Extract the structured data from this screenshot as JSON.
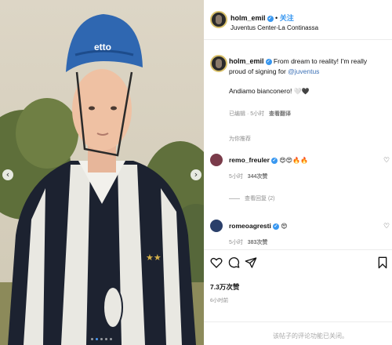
{
  "post": {
    "username": "holm_emil",
    "follow_label": "关注",
    "location": "Juventus Center-La Continassa",
    "caption_text": "From dream to reality! I'm really proud of signing for ",
    "caption_mention": "@juventus",
    "caption_line2": "Andiamo bianconero! ",
    "caption_emoji": "🤍🖤",
    "edited_label": "已编辑",
    "caption_time": "5小时",
    "see_translation": "查看翻译",
    "no_more_label": "为你推荐"
  },
  "comments": [
    {
      "username": "remo_freuler",
      "emoji": "😍😍🔥🔥",
      "time": "5小时",
      "likes": "344次赞",
      "view_replies": "查看回复 (2)",
      "avatar_color": "#7a3b4a"
    },
    {
      "username": "romeoagresti",
      "emoji": "😍",
      "time": "5小时",
      "likes": "383次赞",
      "avatar_color": "#2a3f6a"
    }
  ],
  "actions": {
    "like_icon": "heart-icon",
    "comment_icon": "comment-icon",
    "share_icon": "share-icon",
    "save_icon": "bookmark-icon",
    "likes_count": "7.3万次赞",
    "time_ago": "6小时前"
  },
  "footer": {
    "placeholder": "该帖子的评论功能已关闭。"
  },
  "photo": {
    "helmet_brand": "etto",
    "nav_prev": "‹",
    "nav_next": "›",
    "dot_count": 5,
    "active_dot": 2
  },
  "colors": {
    "link": "#3897f0",
    "verified": "#3897f0"
  }
}
